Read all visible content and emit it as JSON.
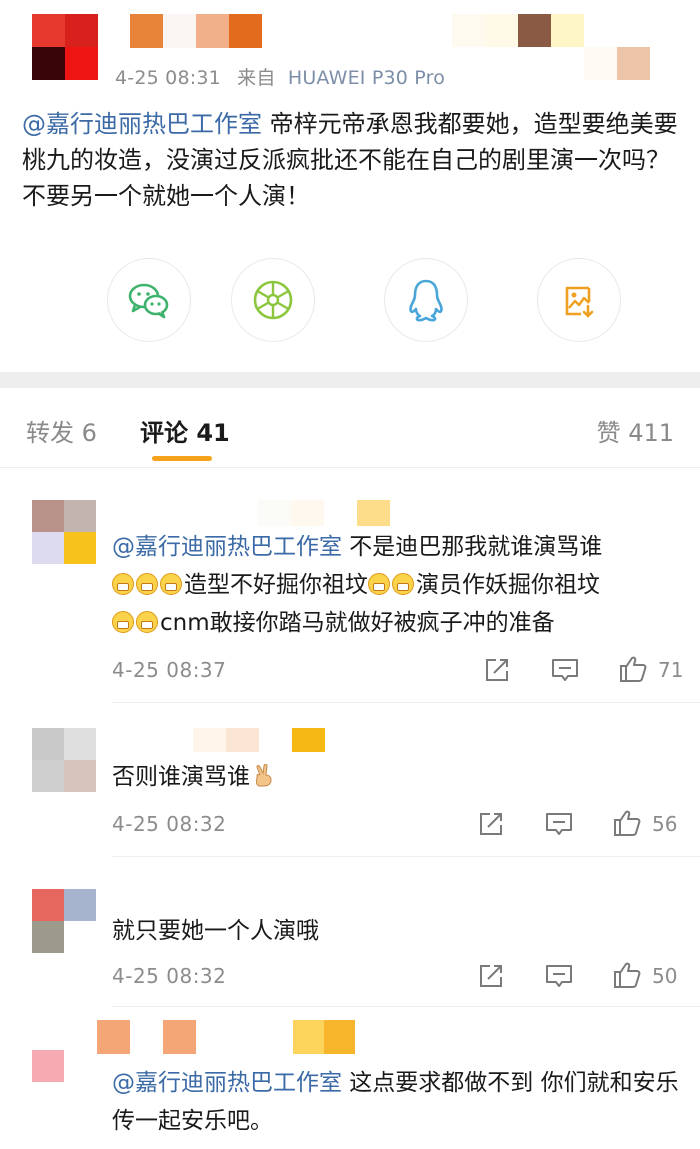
{
  "post": {
    "time": "4-25 08:31",
    "source_prefix": "来自",
    "source_device": "HUAWEI P30 Pro",
    "mention": "@嘉行迪丽热巴工作室",
    "content": " 帝梓元帝承恩我都要她，造型要绝美要桃九的妆造，没演过反派疯批还不能在自己的剧里演一次吗？不要另一个就她一个人演！"
  },
  "share": [
    {
      "name": "wechat-icon",
      "color": "#3fb26e"
    },
    {
      "name": "moments-icon",
      "color": "#8cc63e"
    },
    {
      "name": "qq-icon",
      "color": "#4aa6d9"
    },
    {
      "name": "save-image-icon",
      "color": "#f0a020"
    }
  ],
  "tabs": {
    "repost": "转发 6",
    "comments": "评论 41",
    "likes": "赞 411",
    "active_color": "#f7a21b"
  },
  "comments": [
    {
      "mention": "@嘉行迪丽热巴工作室",
      "part1": " 不是迪巴那我就谁演骂谁",
      "part2": "造型不好掘你祖坟",
      "part3": "演员作妖掘你祖坟",
      "part4": "cnm敢接你踏马就做好被疯子冲的准备",
      "time": "4-25 08:37",
      "likes": "71"
    },
    {
      "text": "否则谁演骂谁",
      "time": "4-25 08:32",
      "likes": "56"
    },
    {
      "text": "就只要她一个人演哦",
      "time": "4-25 08:32",
      "likes": "50"
    },
    {
      "mention": "@嘉行迪丽热巴工作室",
      "text": " 这点要求都做不到 你们就和安乐传一起安乐吧。"
    }
  ]
}
